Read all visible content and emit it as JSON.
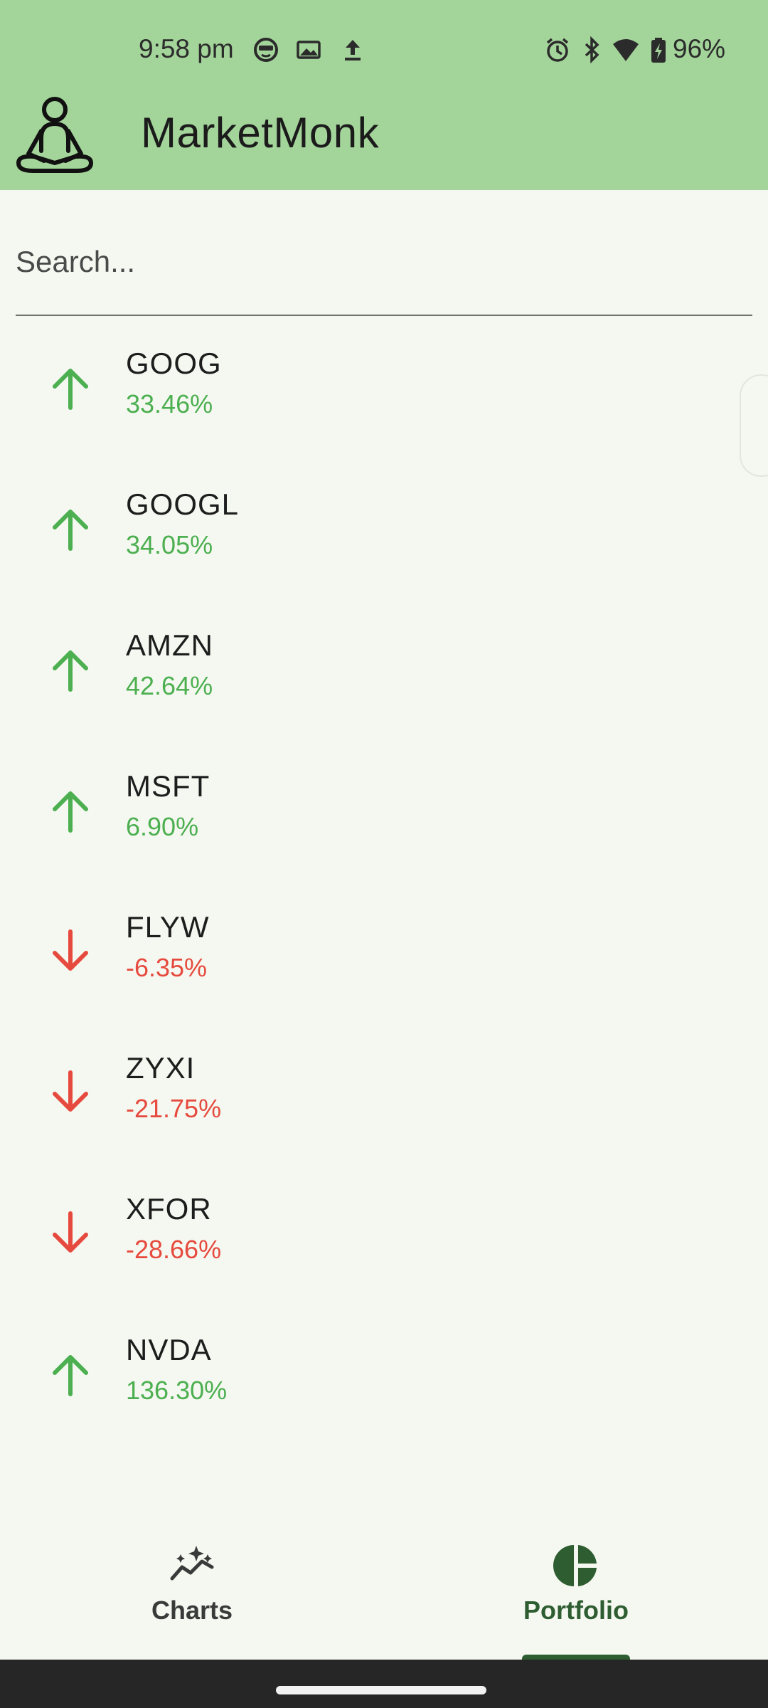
{
  "status_bar": {
    "time": "9:58 pm",
    "battery_percent": "96%",
    "icons": [
      "face-notification-icon",
      "image-notification-icon",
      "upload-icon",
      "alarm-icon",
      "bluetooth-icon",
      "wifi-icon",
      "battery-charging-icon"
    ]
  },
  "app": {
    "title": "MarketMonk",
    "logo_icon": "meditating-person-icon",
    "header_color": "#a3d49a"
  },
  "search": {
    "placeholder": "Search...",
    "value": ""
  },
  "stocks": [
    {
      "ticker": "GOOG",
      "change": "33.46%",
      "direction": "up"
    },
    {
      "ticker": "GOOGL",
      "change": "34.05%",
      "direction": "up"
    },
    {
      "ticker": "AMZN",
      "change": "42.64%",
      "direction": "up"
    },
    {
      "ticker": "MSFT",
      "change": "6.90%",
      "direction": "up"
    },
    {
      "ticker": "FLYW",
      "change": "-6.35%",
      "direction": "down"
    },
    {
      "ticker": "ZYXI",
      "change": "-21.75%",
      "direction": "down"
    },
    {
      "ticker": "XFOR",
      "change": "-28.66%",
      "direction": "down"
    },
    {
      "ticker": "NVDA",
      "change": "136.30%",
      "direction": "up"
    }
  ],
  "colors": {
    "up": "#4caf50",
    "down": "#e64a3e",
    "accent": "#2e5d31"
  },
  "bottom_nav": {
    "items": [
      {
        "label": "Charts",
        "icon": "chart-sparkle-icon",
        "selected": false
      },
      {
        "label": "Portfolio",
        "icon": "pie-chart-icon",
        "selected": true
      }
    ]
  }
}
